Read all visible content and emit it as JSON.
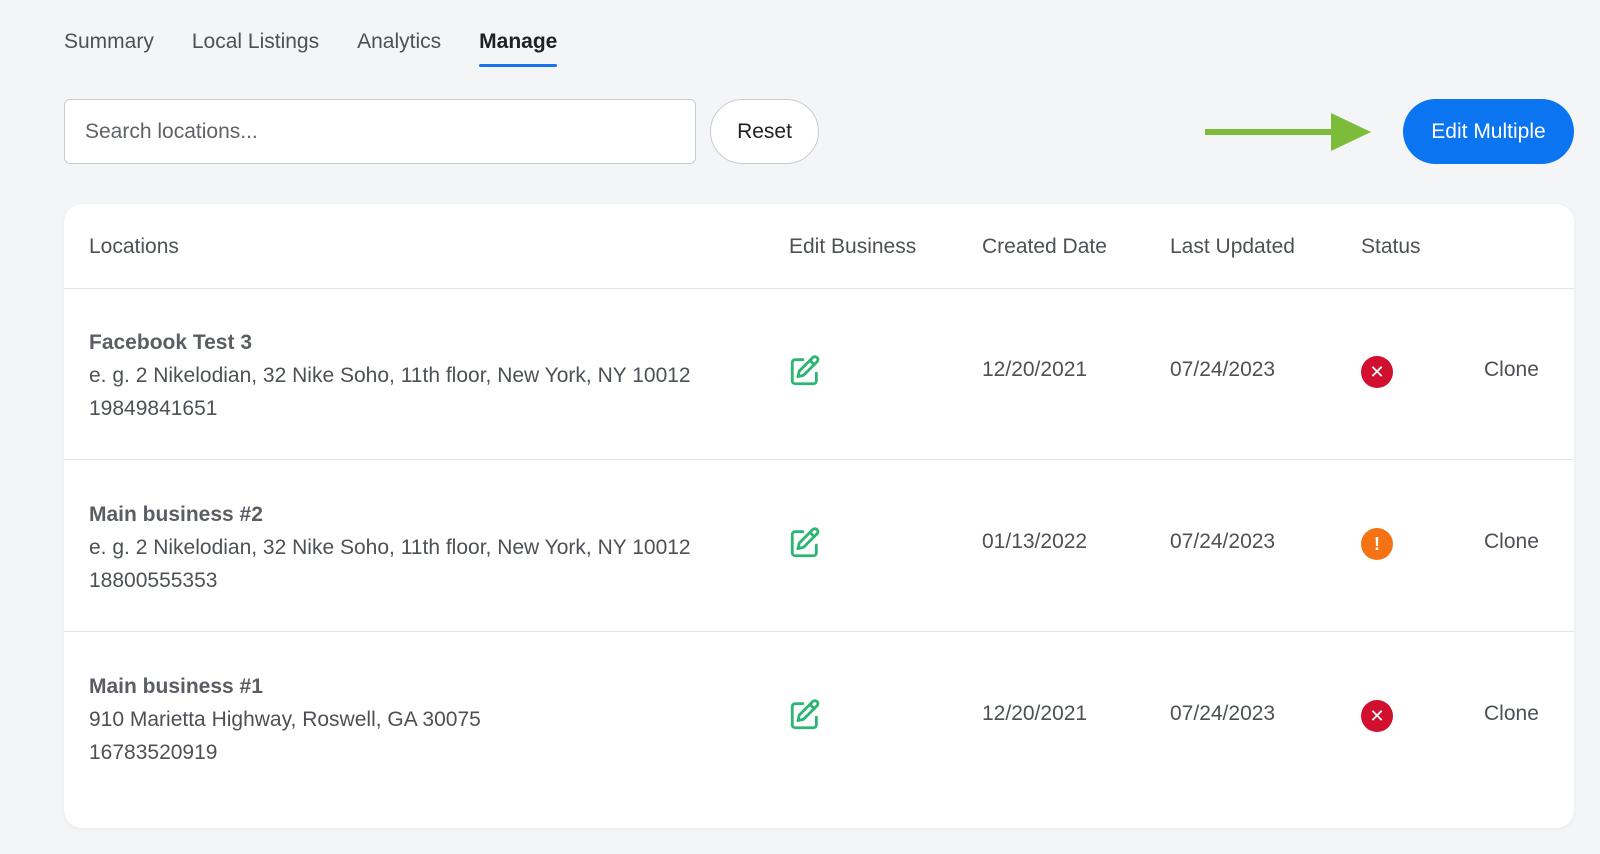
{
  "tabs": [
    {
      "label": "Summary",
      "active": false
    },
    {
      "label": "Local Listings",
      "active": false
    },
    {
      "label": "Analytics",
      "active": false
    },
    {
      "label": "Manage",
      "active": true
    }
  ],
  "search": {
    "placeholder": "Search locations..."
  },
  "reset_label": "Reset",
  "edit_multiple_label": "Edit Multiple",
  "colors": {
    "accent": "#0b74f0",
    "annotation_arrow": "#7dbb3a",
    "edit_icon": "#2bb673",
    "status_error": "#d0102e",
    "status_warning": "#f57314"
  },
  "table": {
    "headers": {
      "locations": "Locations",
      "edit_business": "Edit Business",
      "created_date": "Created Date",
      "last_updated": "Last Updated",
      "status": "Status"
    },
    "rows": [
      {
        "name": "Facebook Test 3",
        "address": "e. g. 2 Nikelodian, 32 Nike Soho, 11th floor, New York, NY 10012",
        "phone": "19849841651",
        "created": "12/20/2021",
        "updated": "07/24/2023",
        "status": "error",
        "action": "Clone"
      },
      {
        "name": "Main business #2",
        "address": "e. g. 2 Nikelodian, 32 Nike Soho, 11th floor, New York, NY 10012",
        "phone": "18800555353",
        "created": "01/13/2022",
        "updated": "07/24/2023",
        "status": "warning",
        "action": "Clone"
      },
      {
        "name": "Main business #1",
        "address": "910 Marietta Highway, Roswell, GA 30075",
        "phone": "16783520919",
        "created": "12/20/2021",
        "updated": "07/24/2023",
        "status": "error",
        "action": "Clone"
      }
    ]
  }
}
